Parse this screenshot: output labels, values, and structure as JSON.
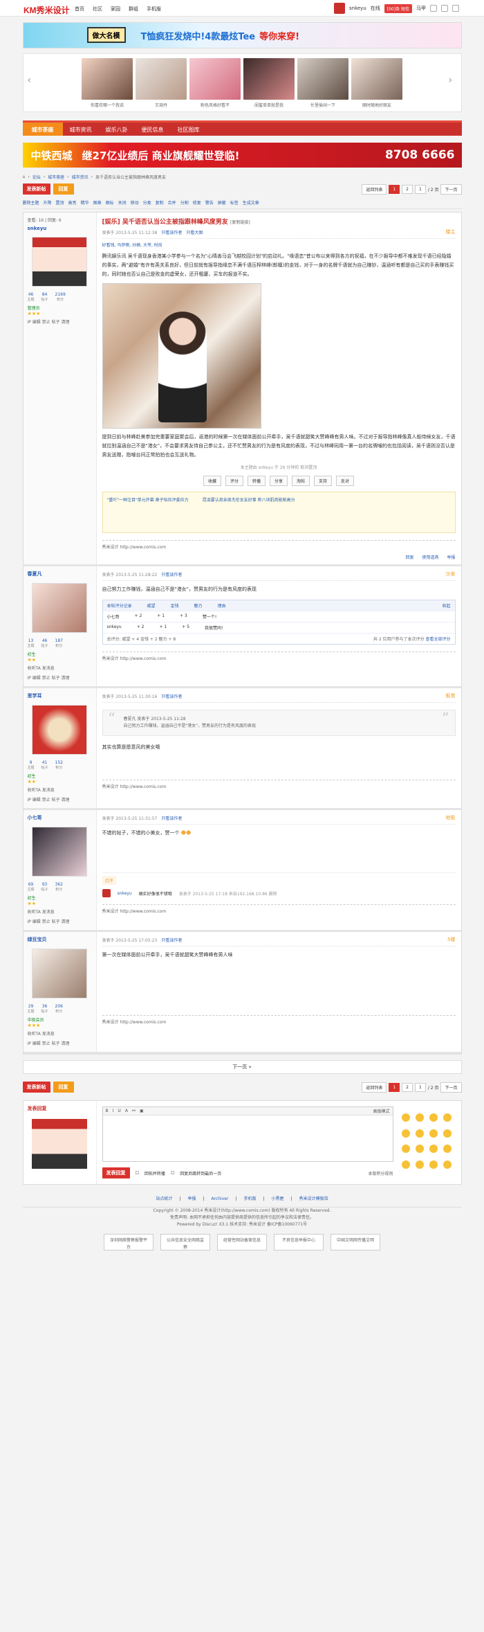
{
  "topbar": {
    "logo": "KM秀米设计",
    "nav": [
      "首页",
      "社区",
      "家园",
      "群组",
      "手机版"
    ],
    "user": "snkeyu",
    "online": "在线",
    "mail": "[00]条 短信",
    "more": "马甲"
  },
  "banner1": {
    "main": "做大名模",
    "sub": "T恤疯狂发烧中!4款最炫Tee",
    "tail": "等你来穿!"
  },
  "slider": {
    "items": [
      {
        "cap": "你喜欢哪一个我说"
      },
      {
        "cap": "王琦丹"
      },
      {
        "cap": "粉色风格好看不"
      },
      {
        "cap": "闺蜜单单就是我"
      },
      {
        "cap": "忙里偷闲一下"
      },
      {
        "cap": "随时随地好丽友"
      }
    ]
  },
  "tabs": [
    "城市茶座",
    "城市资讯",
    "娱乐八卦",
    "便民信息",
    "社区图库"
  ],
  "banner2": {
    "left": "中铁西城",
    "mid": "继27亿业绩后 商业旗舰耀世登临!",
    "phone": "8708 6666"
  },
  "crumb": [
    "论坛",
    "城市茶座",
    "城市资讯",
    "吴千语否认当公主被指跟林峰风度男友"
  ],
  "actbar": {
    "post": "发表新帖",
    "reply": "回复",
    "back": "返回列表",
    "pages": [
      "1",
      "2"
    ],
    "page_input": "1",
    "total": "/ 2 页",
    "next": "下一页"
  },
  "links": [
    "删除主题",
    "升降",
    "置顶",
    "高亮",
    "精华",
    "图章",
    "图标",
    "关闭",
    "移动",
    "分类",
    "复制",
    "合并",
    "分割",
    "修复",
    "警告",
    "屏蔽",
    "标签",
    "生成文章"
  ],
  "stats": {
    "views_label": "查看:",
    "views": "16",
    "replies_label": "回复:",
    "replies": "6"
  },
  "op": {
    "name": "snkeyu",
    "title": "[娱乐] 吴千语否认当公主被指跟林峰风度男友",
    "copy": "[复制链接]",
    "posted": "发表于 2013-5-25 11:12:38",
    "only": "只看该作者",
    "font": "只看大图",
    "floor": "楼主",
    "stats": [
      {
        "n": "46",
        "l": "主题"
      },
      {
        "n": "84",
        "l": "帖子"
      },
      {
        "n": "2169",
        "l": "积分"
      }
    ],
    "group": "管理员",
    "ops": "IP 编辑 禁止 帖子 清理",
    "tags": "好看钱, 马伊俐, 孙楠, 大爷, 时尚",
    "p1": "腾讯娱乐讯 吴千语现身香港某小学参与一个名为\"心晴善马会飞越校园计划\"的启动礼。\"缘语恋\"昔公布以来得到各方的祝福，在不少报导中都不难发现千语已经隐婚的事实，两\"避婚\"有许有英关系良好，但日前就有报导指缘恋不满千语压榨林峰(郎檀)的金钱，对于一身的名牌千语就为自己赚钞，温涵听有都是自己买的手表赚钱买的，同时她也否认自己是败金的虚荣女，还开粗厦、买车的报道不实。",
    "p2": "提到日前与林峰赴美参加完重要家庭聚会后，返港的时候第一次在媒体面前公开牵手，吴千语就甜笑大赞峰峰有男人味。不过对于报导指林峰像真人般侍候女友，千语就拉别温涵自己不是\"港女\"，不会要求男友侍自己参公主，还不忙赞男友的行为是有风度的表现，不过与林峰同用一第一台的名牌嗖的也包括阅读，吴千语则没否认是男友送赠，指嗖台间正常拍拍也会互送礼物。",
    "edit_note": "本主题由 snkeyu 于 26 分钟前 取消置顶",
    "actions": [
      "收藏",
      "评分",
      "转播",
      "分享",
      "淘帖",
      "支持",
      "反对"
    ],
    "related": [
      "\"重吖\"一种注目\"单元开幕 章子怡压评委压力",
      "昆凌要认叔亲周杰伦女友好事 称八块肌肉能帕高分"
    ],
    "sig": "秀米设计 http://www.comis.com",
    "foot": [
      "回复",
      "使用道具",
      "举报"
    ]
  },
  "posts": [
    {
      "name": "春夏凡",
      "posted": "发表于 2013-5-25 11:28:22",
      "only": "只看该作者",
      "floor": "沙发",
      "stats": [
        {
          "n": "13",
          "l": "主题"
        },
        {
          "n": "46",
          "l": "帖子"
        },
        {
          "n": "187",
          "l": "积分"
        }
      ],
      "group": "初生",
      "ops": "收听TA 发消息",
      "ops2": "IP 编辑 禁止 帖子 清理",
      "text": "自己努力工作赚钱，温涵自己不是\"港女\"，赞男友的行为是有风度的表现",
      "rate": {
        "title": "本帖评分记录",
        "cols": [
          "威望",
          "金钱",
          "魅力",
          "理由"
        ],
        "fold": "收起",
        "rows": [
          {
            "u": "小七哥",
            "a": "+ 2",
            "b": "+ 1",
            "c": "+ 3",
            "r": "赞一个!"
          },
          {
            "u": "snkeyu",
            "a": "+ 2",
            "b": "+ 1",
            "c": "+ 5",
            "r": "我很赞同!"
          }
        ],
        "sum": "总评分: 威望 + 4 金钱 + 2 魅力 + 8",
        "sum2": "共 2 位用户参与了本次评分",
        "view": "查看全部评分"
      },
      "sig": "秀米设计 http://www.comis.com"
    },
    {
      "name": "里学耳",
      "posted": "发表于 2013-5-25 11:30:16",
      "only": "只看该作者",
      "floor": "板凳",
      "stats": [
        {
          "n": "9",
          "l": "主题"
        },
        {
          "n": "41",
          "l": "帖子"
        },
        {
          "n": "152",
          "l": "积分"
        }
      ],
      "group": "初生",
      "ops": "收听TA 发消息",
      "ops2": "IP 编辑 禁止 帖子 清理",
      "quote_head": "春夏凡 发表于 2013-5-25 11:28",
      "quote": "自己努力工作赚钱，温涵自己不是\"港女\"，赞男友的行为是有风度的表现",
      "text": "其实也算是愿意风的美女哦",
      "sig": "秀米设计 http://www.comis.com"
    },
    {
      "name": "小七哥",
      "posted": "发表于 2013-5-25 11:31:57",
      "only": "只看该作者",
      "floor": "地板",
      "stats": [
        {
          "n": "69",
          "l": "主题"
        },
        {
          "n": "93",
          "l": "帖子"
        },
        {
          "n": "362",
          "l": "积分"
        }
      ],
      "group": "初生",
      "ops": "收听TA 发消息",
      "ops2": "IP 编辑 禁止 帖子 清理",
      "text": "不错的帖子，不错的小美女，赞一个",
      "comment_label": "点评",
      "comment_user": "snkeyu",
      "comment_text": "确实好像很不错哦",
      "comment_meta": "发表于 2013-5-25 17:18 来自192.168.10.86 删除",
      "sig": "秀米设计 http://www.comis.com"
    },
    {
      "name": "绿豆宝贝",
      "posted": "发表于 2013-5-25 17:05:23",
      "only": "只看该作者",
      "floor": "5楼",
      "stats": [
        {
          "n": "29",
          "l": "主题"
        },
        {
          "n": "36",
          "l": "帖子"
        },
        {
          "n": "206",
          "l": "积分"
        }
      ],
      "group": "中级会员",
      "ops": "收听TA 发消息",
      "ops2": "IP 编辑 禁止 帖子 清理",
      "text": "第一次在媒体面前公开牵手，吴千语就甜笑大赞峰峰有男人味",
      "sig": "秀米设计 http://www.comis.com"
    }
  ],
  "nextpage": "下一页 »",
  "reply": {
    "title": "发表回复",
    "adv": "高级模式",
    "submit": "发表回复",
    "chk1": "回帖并转播",
    "chk2": "回复后跳转到最后一页",
    "rules": "本版积分规则"
  },
  "footer": {
    "links": [
      "站点统计",
      "举报",
      "Archiver",
      "手机版",
      "小黑屋",
      "秀米设计模板馆"
    ],
    "copy": "Copyright © 2008-2014 秀米设计(http://www.comis.com) 版权所有 All Rights Reserved.",
    "note": "免责声明: 本网不承担任何由内容提供商提供的信息所引起的争议和法律责任。",
    "power": "Powered by Discuz! X3.1 技术支持: 秀米设计 备ICP备10060771号",
    "certs": [
      "深圳网络警察报警平台",
      "公共信息安全网络监察",
      "经营性网站备案信息",
      "不良信息举报中心",
      "中国文明网传播文明"
    ]
  }
}
